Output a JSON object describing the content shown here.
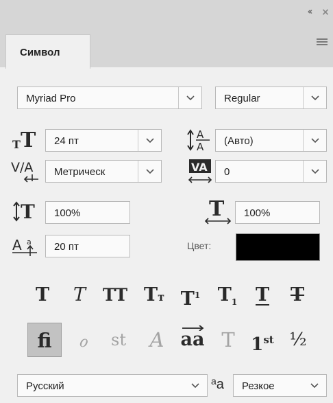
{
  "panel": {
    "tab_title": "Символ",
    "font_family": "Myriad Pro",
    "font_style": "Regular",
    "font_size": "24 пт",
    "leading": "(Авто)",
    "kerning": "Метрическ",
    "tracking": "0",
    "vertical_scale": "100%",
    "horizontal_scale": "100%",
    "baseline_shift": "20 пт",
    "color_label": "Цвет:",
    "color_value": "#000000",
    "language": "Русский",
    "antialias_glyph": "aa",
    "antialias": "Резкое"
  },
  "style_buttons": [
    {
      "name": "faux-bold",
      "glyph": "T"
    },
    {
      "name": "faux-italic",
      "glyph": "T"
    },
    {
      "name": "all-caps",
      "glyph": "TT"
    },
    {
      "name": "small-caps",
      "glyph": "Tт"
    },
    {
      "name": "superscript",
      "glyph": "T¹"
    },
    {
      "name": "subscript",
      "glyph": "T₁"
    },
    {
      "name": "underline",
      "glyph": "T"
    },
    {
      "name": "strikethrough",
      "glyph": "T"
    }
  ],
  "opentype_buttons": [
    {
      "name": "standard-ligatures",
      "glyph": "fi",
      "active": true
    },
    {
      "name": "contextual-alternates",
      "glyph": "ℴ",
      "active": false
    },
    {
      "name": "discretionary-ligatures",
      "glyph": "st",
      "active": false
    },
    {
      "name": "swash",
      "glyph": "𝒜",
      "active": false
    },
    {
      "name": "stylistic-alternates",
      "glyph": "aa",
      "active": true
    },
    {
      "name": "titling-alternates",
      "glyph": "𝕋",
      "active": false
    },
    {
      "name": "ordinals",
      "glyph": "1st",
      "active": true
    },
    {
      "name": "fractions",
      "glyph": "½",
      "active": true
    }
  ]
}
